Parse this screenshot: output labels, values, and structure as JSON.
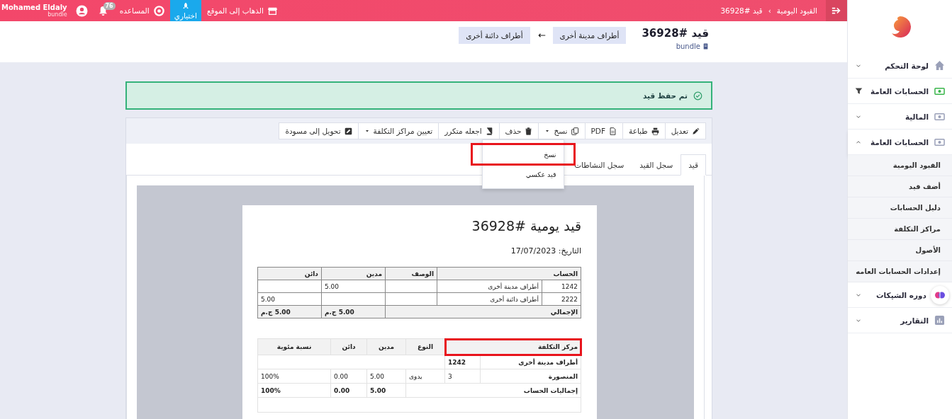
{
  "top_bar": {
    "breadcrumbs": [
      "القيود اليومية",
      "قيد #36928"
    ],
    "breadcrumb_separator": "›",
    "links": [
      {
        "label": "الذهاب إلى الموقع",
        "kind": "site"
      },
      {
        "label": "اختياري",
        "kind": "trial"
      },
      {
        "label": "المساعده",
        "kind": "help"
      }
    ],
    "notifications": "76",
    "user": {
      "name": "Mohamed Eldaly",
      "subtitle": "bundle"
    }
  },
  "header": {
    "title": "قيد #36928",
    "company": "bundle",
    "from_account": "أطراف مدينة أخرى",
    "to_account": "أطراف دائنة أخرى"
  },
  "alert": {
    "message": "تم حفظ قيد"
  },
  "toolbar": [
    {
      "label": "تعديل",
      "has_menu": false
    },
    {
      "label": "طباعة",
      "has_menu": false
    },
    {
      "label": "PDF",
      "has_menu": false
    },
    {
      "label": "نسخ",
      "has_menu": true,
      "menu": [
        {
          "label": "نسخ",
          "highlighted": true
        },
        {
          "label": "قيد عكسي",
          "highlighted": false
        }
      ]
    },
    {
      "label": "حذف",
      "has_menu": false
    },
    {
      "label": "اجعله متكرر",
      "has_menu": false
    },
    {
      "label": "تعيين مراكز التكلفة",
      "has_menu": true
    },
    {
      "label": "تحويل إلى مسودة",
      "has_menu": false
    }
  ],
  "tabs": [
    {
      "label": "قيد",
      "selected": true
    },
    {
      "label": "سجل القيد",
      "selected": false
    },
    {
      "label": "سجل النشاطات",
      "selected": false
    }
  ],
  "document": {
    "title": "قيد يومية #36928",
    "date": "التاريخ: 17/07/2023",
    "entries": {
      "columns": [
        "الحساب",
        "الوصف",
        "مدين",
        "دائن"
      ],
      "rows": [
        {
          "code": "1242",
          "account": "أطراف مدينة أخرى",
          "debit": "5.00"
        },
        {
          "code": "2222",
          "account": "أطراف دائنة أخرى",
          "credit": "5.00"
        }
      ],
      "total": {
        "label": "الإجمالي",
        "debit": "5.00 ج.م",
        "credit": "5.00 ج.م"
      }
    },
    "cost_centers": {
      "columns": [
        {
          "label": "مركز التكلفة",
          "highlighted": true
        },
        {
          "label": "النوع",
          "highlighted": false
        },
        {
          "label": "مدين",
          "highlighted": false
        },
        {
          "label": "دائن",
          "highlighted": false
        },
        {
          "label": "نسبة مئوية",
          "highlighted": false
        }
      ],
      "groups": [
        {
          "account": "أطراف مدينة أخرى",
          "code": "1242",
          "rows": [
            {
              "name": "المنصورة",
              "number": "3",
              "type": "يدوى",
              "debit": "5.00",
              "credit": "0.00",
              "percent": "100%"
            }
          ],
          "total": {
            "label": "إجماليات الحساب",
            "debit": "5.00",
            "credit": "0.00",
            "percent": "100%"
          }
        }
      ]
    }
  },
  "sidebar": {
    "items": [
      {
        "label": "لوحة التحكم",
        "kind": "menu",
        "expanded": false
      },
      {
        "label": "الحسابات العامة",
        "kind": "pinned"
      },
      {
        "label": "المالية",
        "kind": "menu",
        "expanded": false
      },
      {
        "label": "الحسابات العامة",
        "kind": "menu",
        "expanded": true,
        "children": [
          {
            "label": "القيود اليومية"
          },
          {
            "label": "أضف قيد"
          },
          {
            "label": "دليل الحسابات"
          },
          {
            "label": "مراكز التكلفة"
          },
          {
            "label": "الأصول"
          },
          {
            "label": "إعدادات الحسابات العامه"
          }
        ]
      },
      {
        "label": "دوره الشيكات",
        "kind": "menu",
        "expanded": false
      },
      {
        "label": "التقارير",
        "kind": "menu",
        "expanded": false
      }
    ]
  }
}
